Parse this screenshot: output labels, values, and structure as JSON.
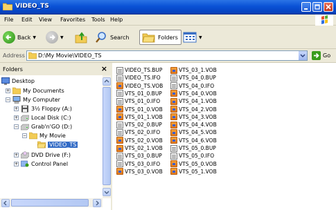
{
  "window": {
    "title": "VIDEO_TS"
  },
  "menu": [
    "File",
    "Edit",
    "View",
    "Favorites",
    "Tools",
    "Help"
  ],
  "toolbar": {
    "back_label": "Back",
    "search_label": "Search",
    "folders_label": "Folders"
  },
  "address": {
    "label": "Address",
    "value": "D:\\My Movie\\VIDEO_TS",
    "go_label": "Go"
  },
  "folders_pane": {
    "title": "Folders",
    "tree": [
      {
        "label": "Desktop",
        "icon": "desktop-icon"
      },
      {
        "label": "My Documents",
        "icon": "folder-icon"
      },
      {
        "label": "My Computer",
        "icon": "computer-icon"
      },
      {
        "label": "3½ Floppy (A:)",
        "icon": "floppy-icon"
      },
      {
        "label": "Local Disk (C:)",
        "icon": "disk-icon"
      },
      {
        "label": "Grab'n'GO (D:)",
        "icon": "disk-icon"
      },
      {
        "label": "My Movie",
        "icon": "folder-icon"
      },
      {
        "label": "VIDEO_TS",
        "icon": "open-folder-icon"
      },
      {
        "label": "DVD Drive (F:)",
        "icon": "dvd-icon"
      },
      {
        "label": "Control Panel",
        "icon": "control-panel-icon"
      }
    ]
  },
  "files": {
    "column1": [
      {
        "name": "VIDEO_TS.BUP",
        "type": "doc"
      },
      {
        "name": "VIDEO_TS.IFO",
        "type": "doc"
      },
      {
        "name": "VIDEO_TS.VOB",
        "type": "vob"
      },
      {
        "name": "VTS_01_0.BUP",
        "type": "doc"
      },
      {
        "name": "VTS_01_0.IFO",
        "type": "doc"
      },
      {
        "name": "VTS_01_0.VOB",
        "type": "vob"
      },
      {
        "name": "VTS_01_1.VOB",
        "type": "vob"
      },
      {
        "name": "VTS_02_0.BUP",
        "type": "doc"
      },
      {
        "name": "VTS_02_0.IFO",
        "type": "doc"
      },
      {
        "name": "VTS_02_0.VOB",
        "type": "vob"
      },
      {
        "name": "VTS_02_1.VOB",
        "type": "vob"
      },
      {
        "name": "VTS_03_0.BUP",
        "type": "doc"
      },
      {
        "name": "VTS_03_0.IFO",
        "type": "doc"
      },
      {
        "name": "VTS_03_0.VOB",
        "type": "vob"
      }
    ],
    "column2": [
      {
        "name": "VTS_03_1.VOB",
        "type": "vob"
      },
      {
        "name": "VTS_04_0.BUP",
        "type": "doc"
      },
      {
        "name": "VTS_04_0.IFO",
        "type": "doc"
      },
      {
        "name": "VTS_04_0.VOB",
        "type": "vob"
      },
      {
        "name": "VTS_04_1.VOB",
        "type": "vob"
      },
      {
        "name": "VTS_04_2.VOB",
        "type": "vob"
      },
      {
        "name": "VTS_04_3.VOB",
        "type": "vob"
      },
      {
        "name": "VTS_04_4.VOB",
        "type": "vob"
      },
      {
        "name": "VTS_04_5.VOB",
        "type": "vob"
      },
      {
        "name": "VTS_04_6.VOB",
        "type": "vob"
      },
      {
        "name": "VTS_05_0.BUP",
        "type": "doc"
      },
      {
        "name": "VTS_05_0.IFO",
        "type": "doc"
      },
      {
        "name": "VTS_05_0.VOB",
        "type": "vob"
      },
      {
        "name": "VTS_05_1.VOB",
        "type": "vob"
      }
    ]
  },
  "colors": {
    "titlebar": "#0a52d6",
    "selection": "#316ac5",
    "window_bg": "#ece9d8"
  }
}
